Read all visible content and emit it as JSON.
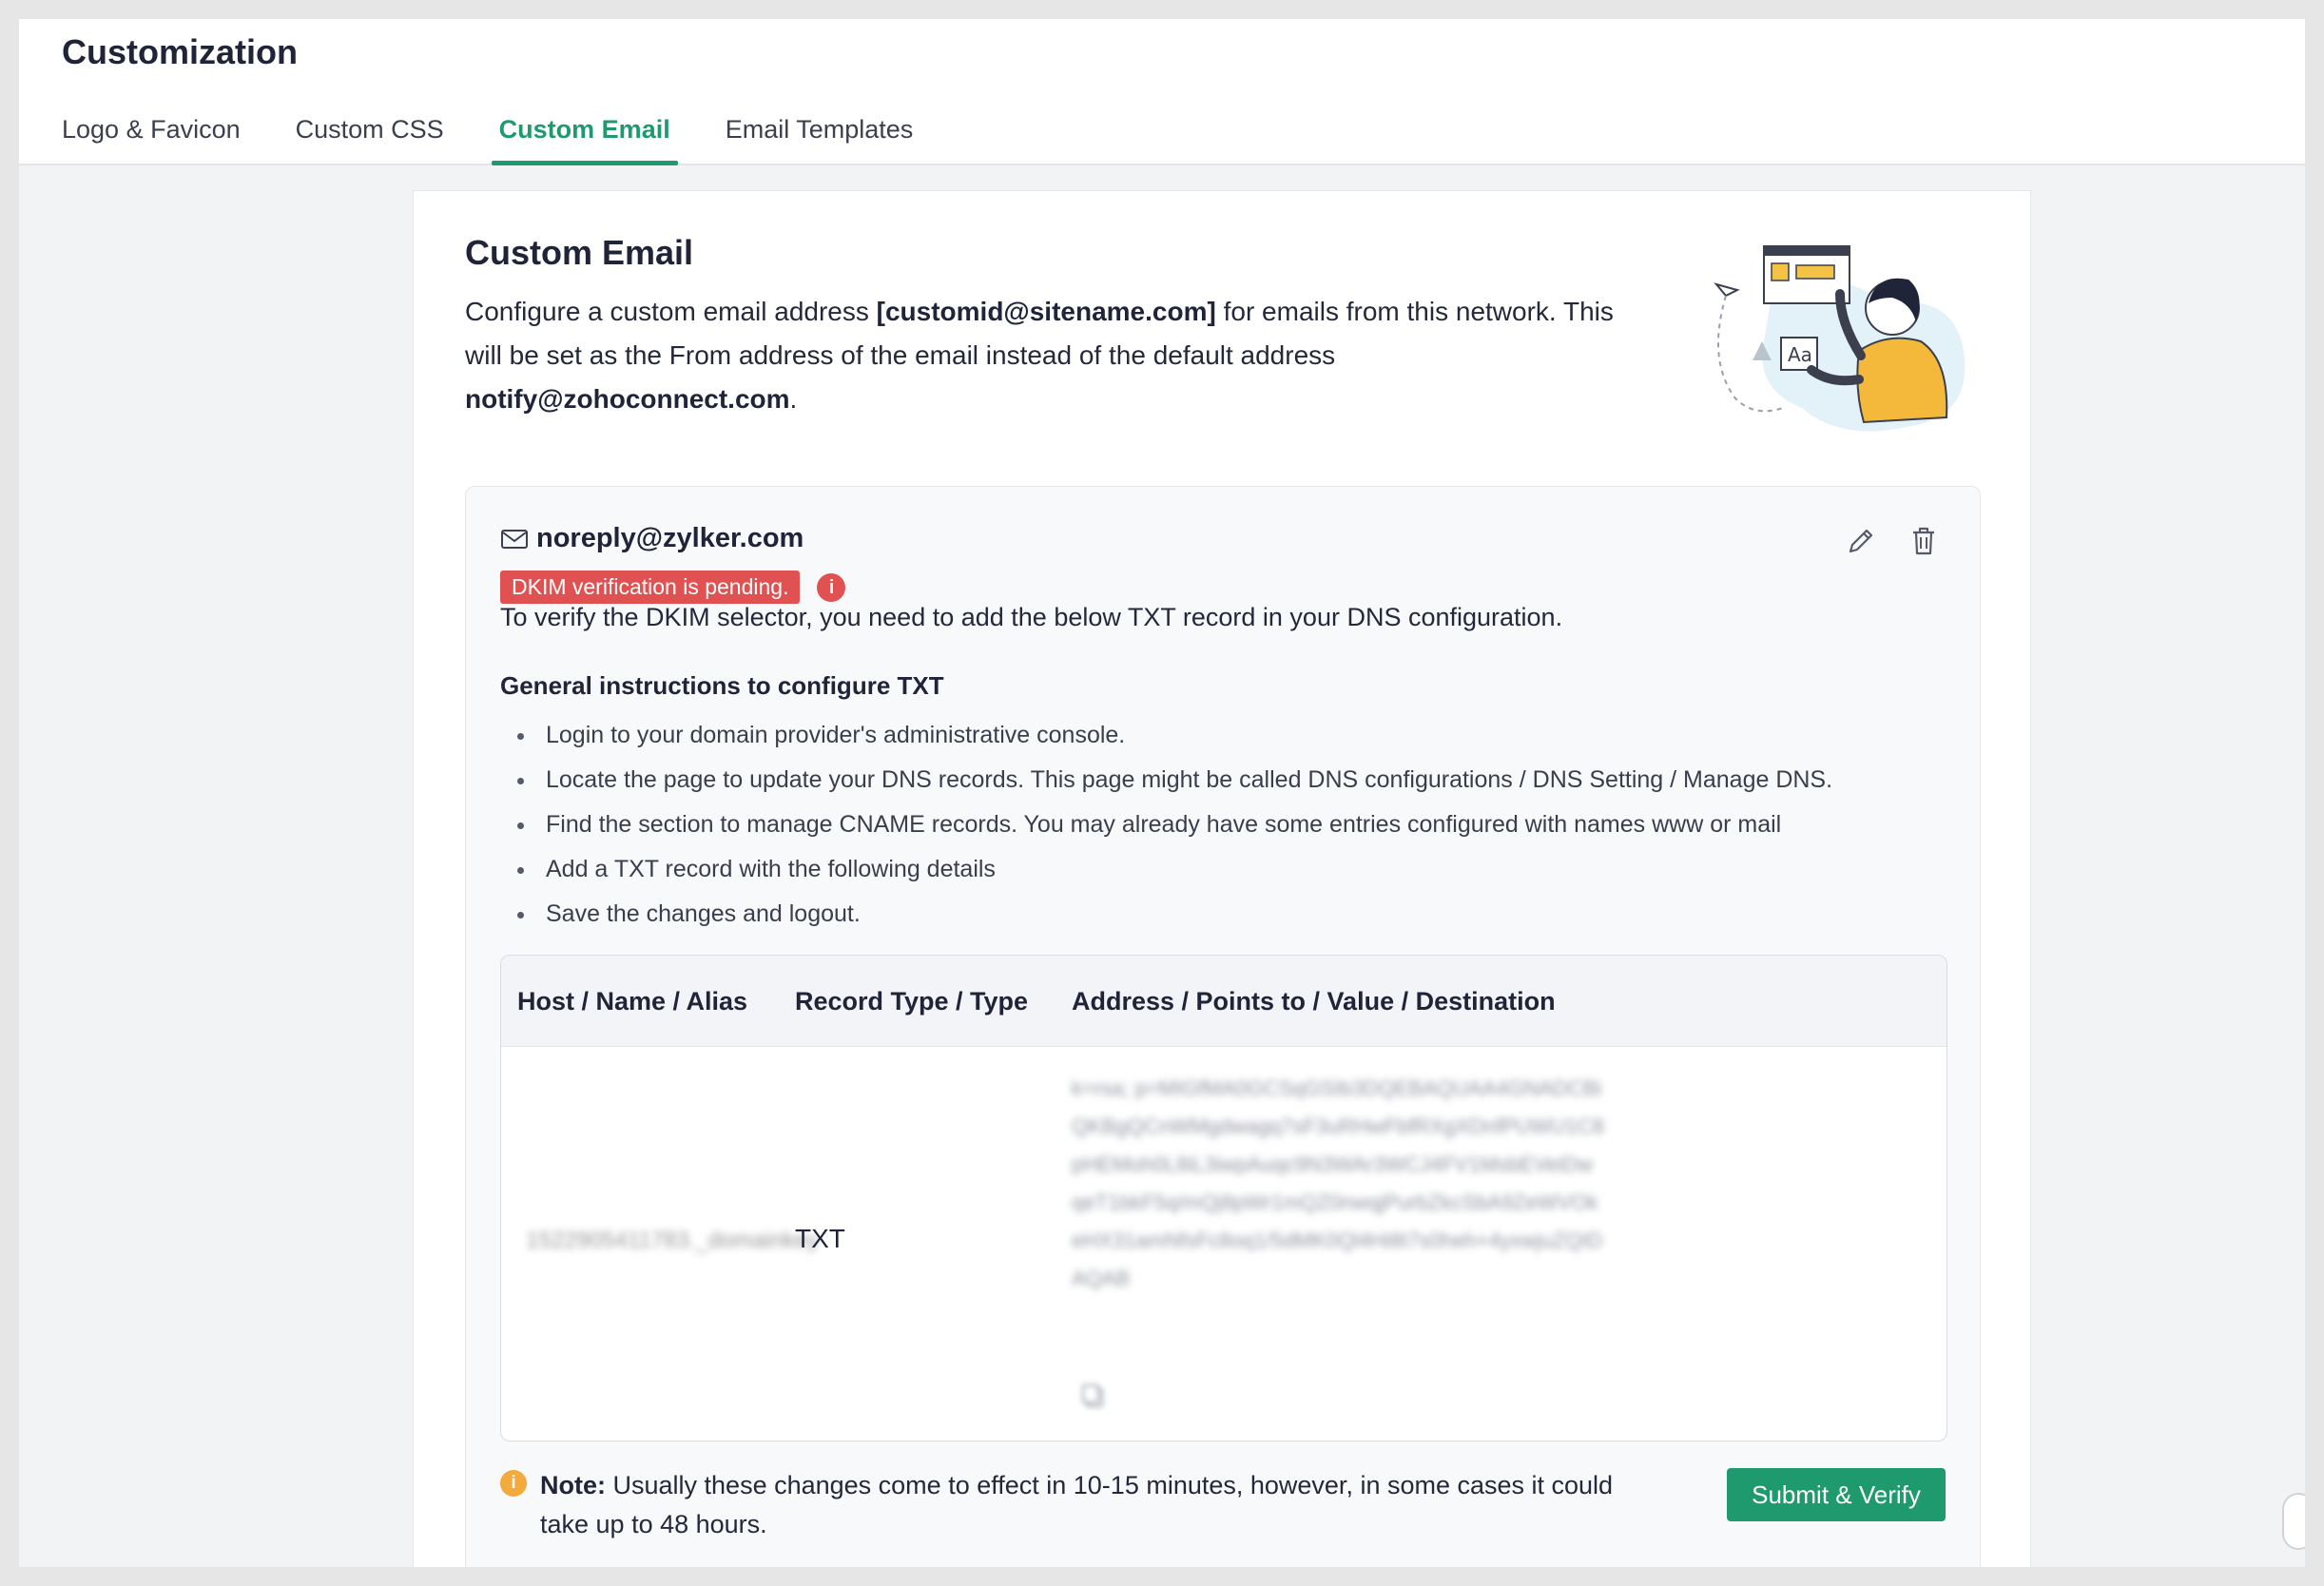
{
  "header": {
    "title": "Customization",
    "tabs": [
      {
        "label": "Logo & Favicon",
        "active": false
      },
      {
        "label": "Custom CSS",
        "active": false
      },
      {
        "label": "Custom Email",
        "active": true
      },
      {
        "label": "Email Templates",
        "active": false
      }
    ]
  },
  "card": {
    "title": "Custom Email",
    "desc_prefix": "Configure a custom email address ",
    "desc_bold_address": "[customid@sitename.com]",
    "desc_middle": " for emails from this network. This will be set as the From address of the email instead of the default address ",
    "desc_bold_default": "notify@zohoconnect.com",
    "desc_suffix": "."
  },
  "email_entry": {
    "address": "noreply@zylker.com",
    "status_badge": "DKIM verification is pending.",
    "verify_text": "To verify the DKIM selector, you need to add the below TXT record in your DNS configuration.",
    "instructions_title": "General instructions to configure TXT",
    "instructions": [
      "Login to your domain provider's administrative console.",
      "Locate the page to update your DNS records. This page might be called DNS configurations / DNS Setting / Manage DNS.",
      "Find the section to manage CNAME records. You may already have some entries configured with names www or mail",
      "Add a TXT record with the following details",
      "Save the changes and logout."
    ]
  },
  "dns_table": {
    "columns": [
      "Host / Name / Alias",
      "Record Type / Type",
      "Address / Points to / Value / Destination"
    ],
    "row": {
      "host": "1522905411783._domainkey",
      "type": "TXT",
      "value": "k=rsa; p=MIGfMA0GCSqGSIb3DQEBAQUAA4GNADCBiQKBgQCnWMgdwagq7sF3uRHwFbfRXgXDnfPUWU1C8pHEMoh0L8iL3iwpAuqc9N3WAr3WCJ4FV1MsbEVeiDwqeT1bkF5q/mQj8pWr1mQZ0nwqjPurbZkcSbA9ZeWVOkeHX31amNfsFc8oq1/5dMK0Ql4Hi8t7s0heh+4yxwjuZQIDAQAB"
    },
    "copy_icon": "copy-icon"
  },
  "note": {
    "label": "Note:",
    "text": " Usually these changes come to effect in 10-15 minutes, however, in some cases it could take up to 48 hours."
  },
  "submit_button": "Submit & Verify",
  "colors": {
    "accent": "#1f9a6e",
    "danger": "#e05252",
    "warning": "#f3a93b"
  },
  "icons": {
    "email": "envelope-icon",
    "edit": "pencil-icon",
    "delete": "trash-icon",
    "status_info": "info-icon",
    "note_info": "info-icon"
  }
}
